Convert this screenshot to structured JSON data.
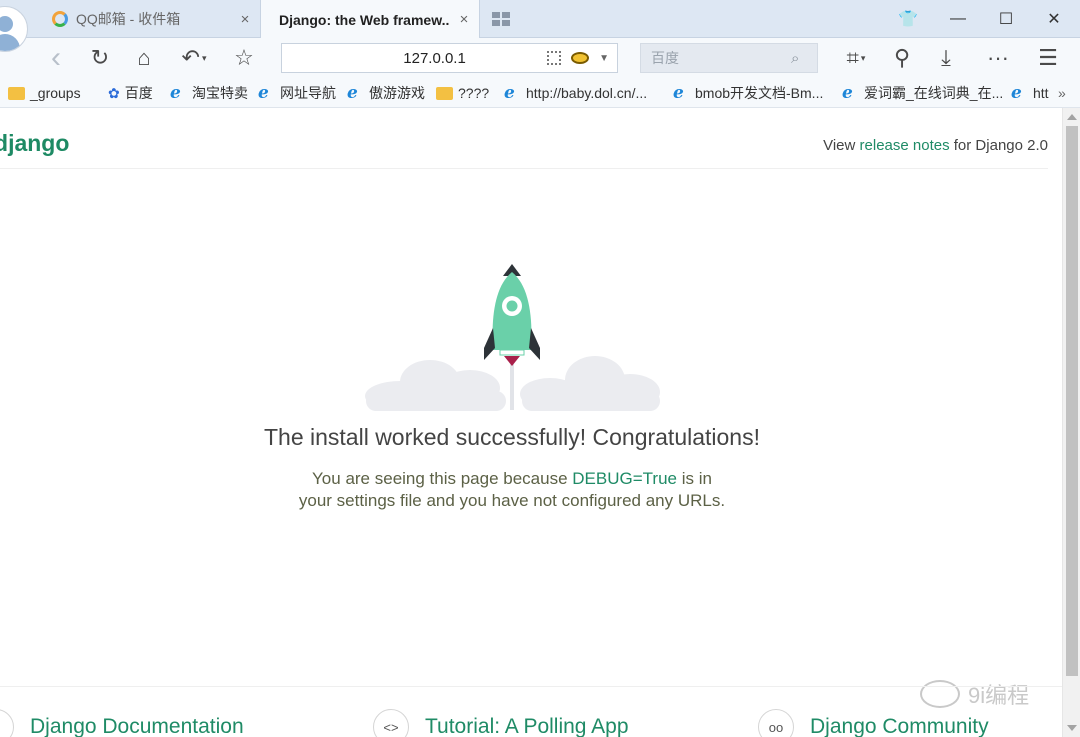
{
  "tabs": [
    {
      "title": "QQ邮箱 - 收件箱",
      "close": "×"
    },
    {
      "title": "Django: the Web framew...",
      "close": "×"
    }
  ],
  "window_controls": {
    "skin": "👕",
    "minimize": "—",
    "maximize": "☐",
    "close": "✕"
  },
  "toolbar": {
    "back": "‹",
    "refresh": "↻",
    "home": "⌂",
    "undo": "↶",
    "favorite": "☆",
    "url": "127.0.0.1",
    "search_placeholder": "百度",
    "screenshot": "⌗",
    "translate": "⚲",
    "download": "⤓",
    "more": "···",
    "menu": "☰"
  },
  "bookmarks": [
    {
      "label": "_groups",
      "icon": "folder"
    },
    {
      "label": "百度",
      "icon": "baidu-paw"
    },
    {
      "label": "淘宝特卖",
      "icon": "ie"
    },
    {
      "label": "网址导航",
      "icon": "ie"
    },
    {
      "label": "傲游游戏",
      "icon": "ie"
    },
    {
      "label": "????",
      "icon": "folder"
    },
    {
      "label": "http://baby.dol.cn/...",
      "icon": "ie"
    },
    {
      "label": "bmob开发文档-Bm...",
      "icon": "ie"
    },
    {
      "label": "爱词霸_在线词典_在...",
      "icon": "ie"
    },
    {
      "label": "htt",
      "icon": "ie"
    }
  ],
  "bookmarks_overflow": "»",
  "page": {
    "logo_prefix": "d",
    "logo": "jango",
    "release_prefix": "View ",
    "release_link": "release notes",
    "release_suffix": " for Django 2.0",
    "headline": "The install worked successfully! Congratulations!",
    "sub_1": "You are seeing this page because ",
    "sub_highlight": "DEBUG=True",
    "sub_2": " is in your settings file and you have not configured any URLs.",
    "footer": [
      {
        "label": "Django Documentation",
        "icon": ""
      },
      {
        "label": "Tutorial: A Polling App",
        "icon": "<>"
      },
      {
        "label": "Django Community",
        "icon": "oo"
      }
    ],
    "watermark": "9i编程"
  },
  "colors": {
    "accent": "#1f8b66",
    "logo_dark": "#0c4b33",
    "rocket": "#6ad0a9"
  }
}
